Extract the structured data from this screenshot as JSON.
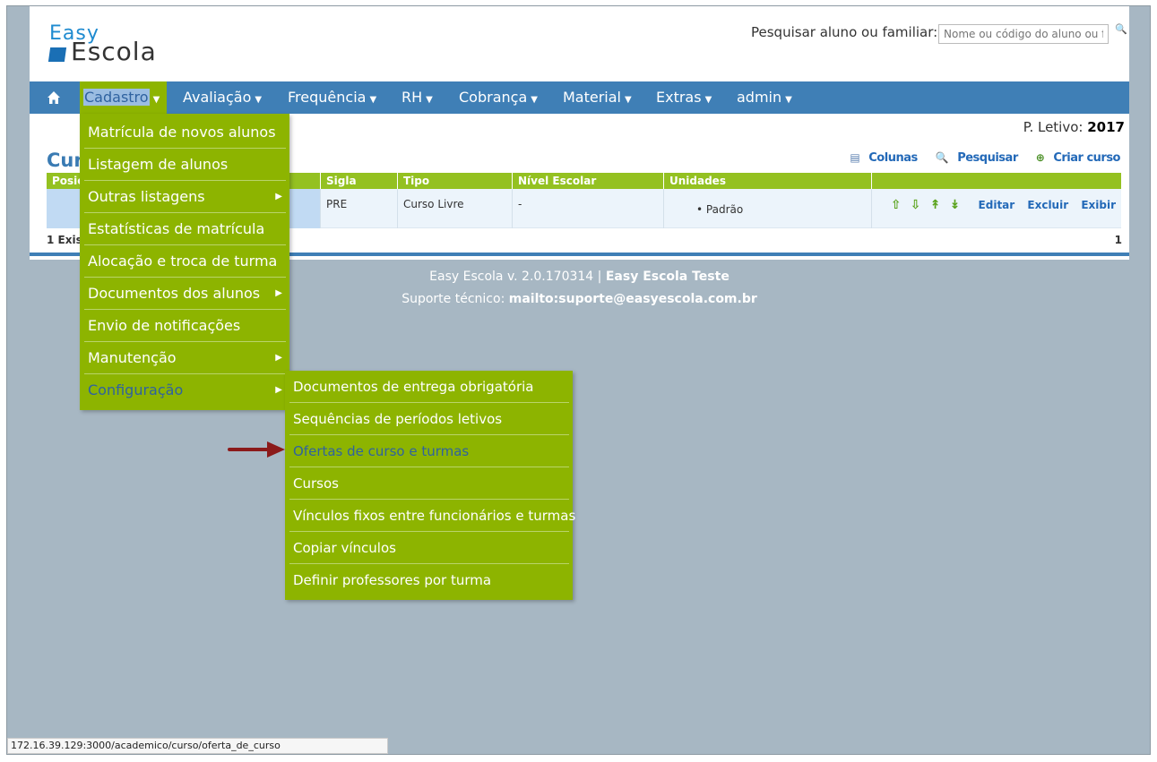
{
  "logo": {
    "line1": "Easy",
    "line2": "Escola"
  },
  "search": {
    "label": "Pesquisar aluno ou familiar:",
    "placeholder": "Nome ou código do aluno ou fa"
  },
  "nav": {
    "items": [
      {
        "label": "Cadastro"
      },
      {
        "label": "Avaliação"
      },
      {
        "label": "Frequência"
      },
      {
        "label": "RH"
      },
      {
        "label": "Cobrança"
      },
      {
        "label": "Material"
      },
      {
        "label": "Extras"
      },
      {
        "label": "admin"
      }
    ]
  },
  "periodo": {
    "label": "P. Letivo:",
    "value": "2017"
  },
  "main": {
    "title": "Cur",
    "actions": {
      "colunas": "Colunas",
      "pesquisar": "Pesquisar",
      "criar": "Criar curso"
    }
  },
  "table": {
    "headers": [
      "Posiç",
      "Sigla",
      "Tipo",
      "Nível Escolar",
      "Unidades"
    ],
    "row": {
      "sigla": "PRE",
      "tipo": "Curso Livre",
      "nivel": "-",
      "unidade": "Padrão"
    },
    "row_links": {
      "editar": "Editar",
      "excluir": "Excluir",
      "exibir": "Exibir"
    },
    "footer_left": "1 Exis",
    "footer_right": "1"
  },
  "footer": {
    "version": "Easy Escola v. 2.0.170314",
    "sep": "|",
    "school": "Easy Escola Teste",
    "support_label": "Suporte técnico:",
    "support_value": "mailto:suporte@easyescola.com.br"
  },
  "dropdown": {
    "items": [
      {
        "label": "Matrícula de novos alunos"
      },
      {
        "label": "Listagem de alunos"
      },
      {
        "label": "Outras listagens"
      },
      {
        "label": "Estatísticas de matrícula"
      },
      {
        "label": "Alocação e troca de turma"
      },
      {
        "label": "Documentos dos alunos"
      },
      {
        "label": "Envio de notificações"
      },
      {
        "label": "Manutenção"
      },
      {
        "label": "Configuração"
      }
    ]
  },
  "submenu": {
    "items": [
      {
        "label": "Documentos de entrega obrigatória"
      },
      {
        "label": "Sequências de períodos letivos"
      },
      {
        "label": "Ofertas de curso e turmas"
      },
      {
        "label": "Cursos"
      },
      {
        "label": "Vínculos fixos entre funcionários e turmas"
      },
      {
        "label": "Copiar vínculos"
      },
      {
        "label": "Definir professores por turma"
      }
    ]
  },
  "status_url": "172.16.39.129:3000/academico/curso/oferta_de_curso",
  "colors": {
    "nav_blue": "#3f7fb6",
    "menu_green": "#8db400",
    "page_bg": "#a7b7c3",
    "link_blue": "#2369b8"
  }
}
